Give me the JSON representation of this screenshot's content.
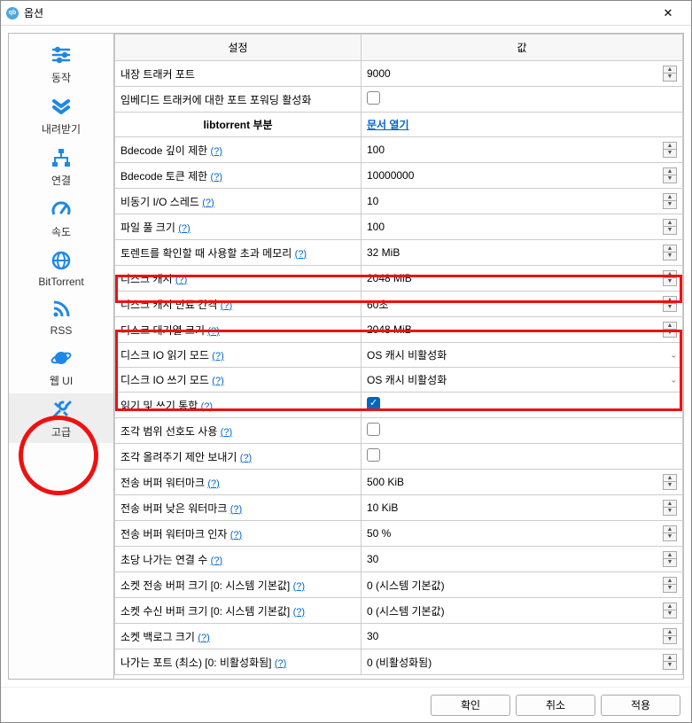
{
  "window": {
    "title": "옵션"
  },
  "sidebar": {
    "items": [
      {
        "label": "동작"
      },
      {
        "label": "내려받기"
      },
      {
        "label": "연결"
      },
      {
        "label": "속도"
      },
      {
        "label": "BitTorrent"
      },
      {
        "label": "RSS"
      },
      {
        "label": "웹 UI"
      },
      {
        "label": "고급"
      }
    ]
  },
  "headers": {
    "setting": "설정",
    "value": "값"
  },
  "link_doc": "문서 열기",
  "section_libtorrent": "libtorrent 부분",
  "help": "(?)",
  "rows": [
    {
      "label": "내장 트래커 포트",
      "value": "9000",
      "type": "spin"
    },
    {
      "label": "임베디드 트래커에 대한 포트 포워딩 활성화",
      "type": "check",
      "checked": false
    },
    {
      "label": "Bdecode 깊이 제한",
      "value": "100",
      "type": "spin",
      "help": true
    },
    {
      "label": "Bdecode 토큰 제한",
      "value": "10000000",
      "type": "spin",
      "help": true
    },
    {
      "label": "비동기 I/O 스레드",
      "value": "10",
      "type": "spin",
      "help": true
    },
    {
      "label": "파일 풀 크기",
      "value": "100",
      "type": "spin",
      "help": true
    },
    {
      "label": "토렌트를 확인할 때 사용할 초과 메모리",
      "value": "32 MiB",
      "type": "spin",
      "help": true
    },
    {
      "label": "디스크 캐시",
      "value": "2048 MiB",
      "type": "spin",
      "help": true,
      "hl": true
    },
    {
      "label": "디스크 캐시 만료 간격",
      "value": "60초",
      "type": "spin",
      "help": true
    },
    {
      "label": "디스크 대기열 크기",
      "value": "2048 MiB",
      "type": "spin",
      "help": true
    },
    {
      "label": "디스크 IO 읽기 모드",
      "value": "OS 캐시 비활성화",
      "type": "select",
      "help": true
    },
    {
      "label": "디스크 IO 쓰기 모드",
      "value": "OS 캐시 비활성화",
      "type": "select",
      "help": true
    },
    {
      "label": "읽기 및 쓰기 통합",
      "type": "check",
      "checked": true,
      "help": true
    },
    {
      "label": "조각 범위 선호도 사용",
      "type": "check",
      "checked": false,
      "help": true
    },
    {
      "label": "조각 올려주기 제안 보내기",
      "type": "check",
      "checked": false,
      "help": true
    },
    {
      "label": "전송 버퍼 워터마크",
      "value": "500 KiB",
      "type": "spin",
      "help": true
    },
    {
      "label": "전송 버퍼 낮은 워터마크",
      "value": "10 KiB",
      "type": "spin",
      "help": true
    },
    {
      "label": "전송 버퍼 워터마크 인자",
      "value": "50 %",
      "type": "spin",
      "help": true
    },
    {
      "label": "초당 나가는 연결 수",
      "value": "30",
      "type": "spin",
      "help": true
    },
    {
      "label": "소켓 전송 버퍼 크기 [0: 시스템 기본값]",
      "value": "0 (시스템 기본값)",
      "type": "spin",
      "help": true
    },
    {
      "label": "소켓 수신 버퍼 크기 [0: 시스템 기본값]",
      "value": "0 (시스템 기본값)",
      "type": "spin",
      "help": true
    },
    {
      "label": "소켓 백로그 크기",
      "value": "30",
      "type": "spin",
      "help": true
    },
    {
      "label": "나가는 포트 (최소) [0: 비활성화됨]",
      "value": "0 (비활성화됨)",
      "type": "spin",
      "help": true
    }
  ],
  "footer": {
    "ok": "확인",
    "cancel": "취소",
    "apply": "적용"
  }
}
